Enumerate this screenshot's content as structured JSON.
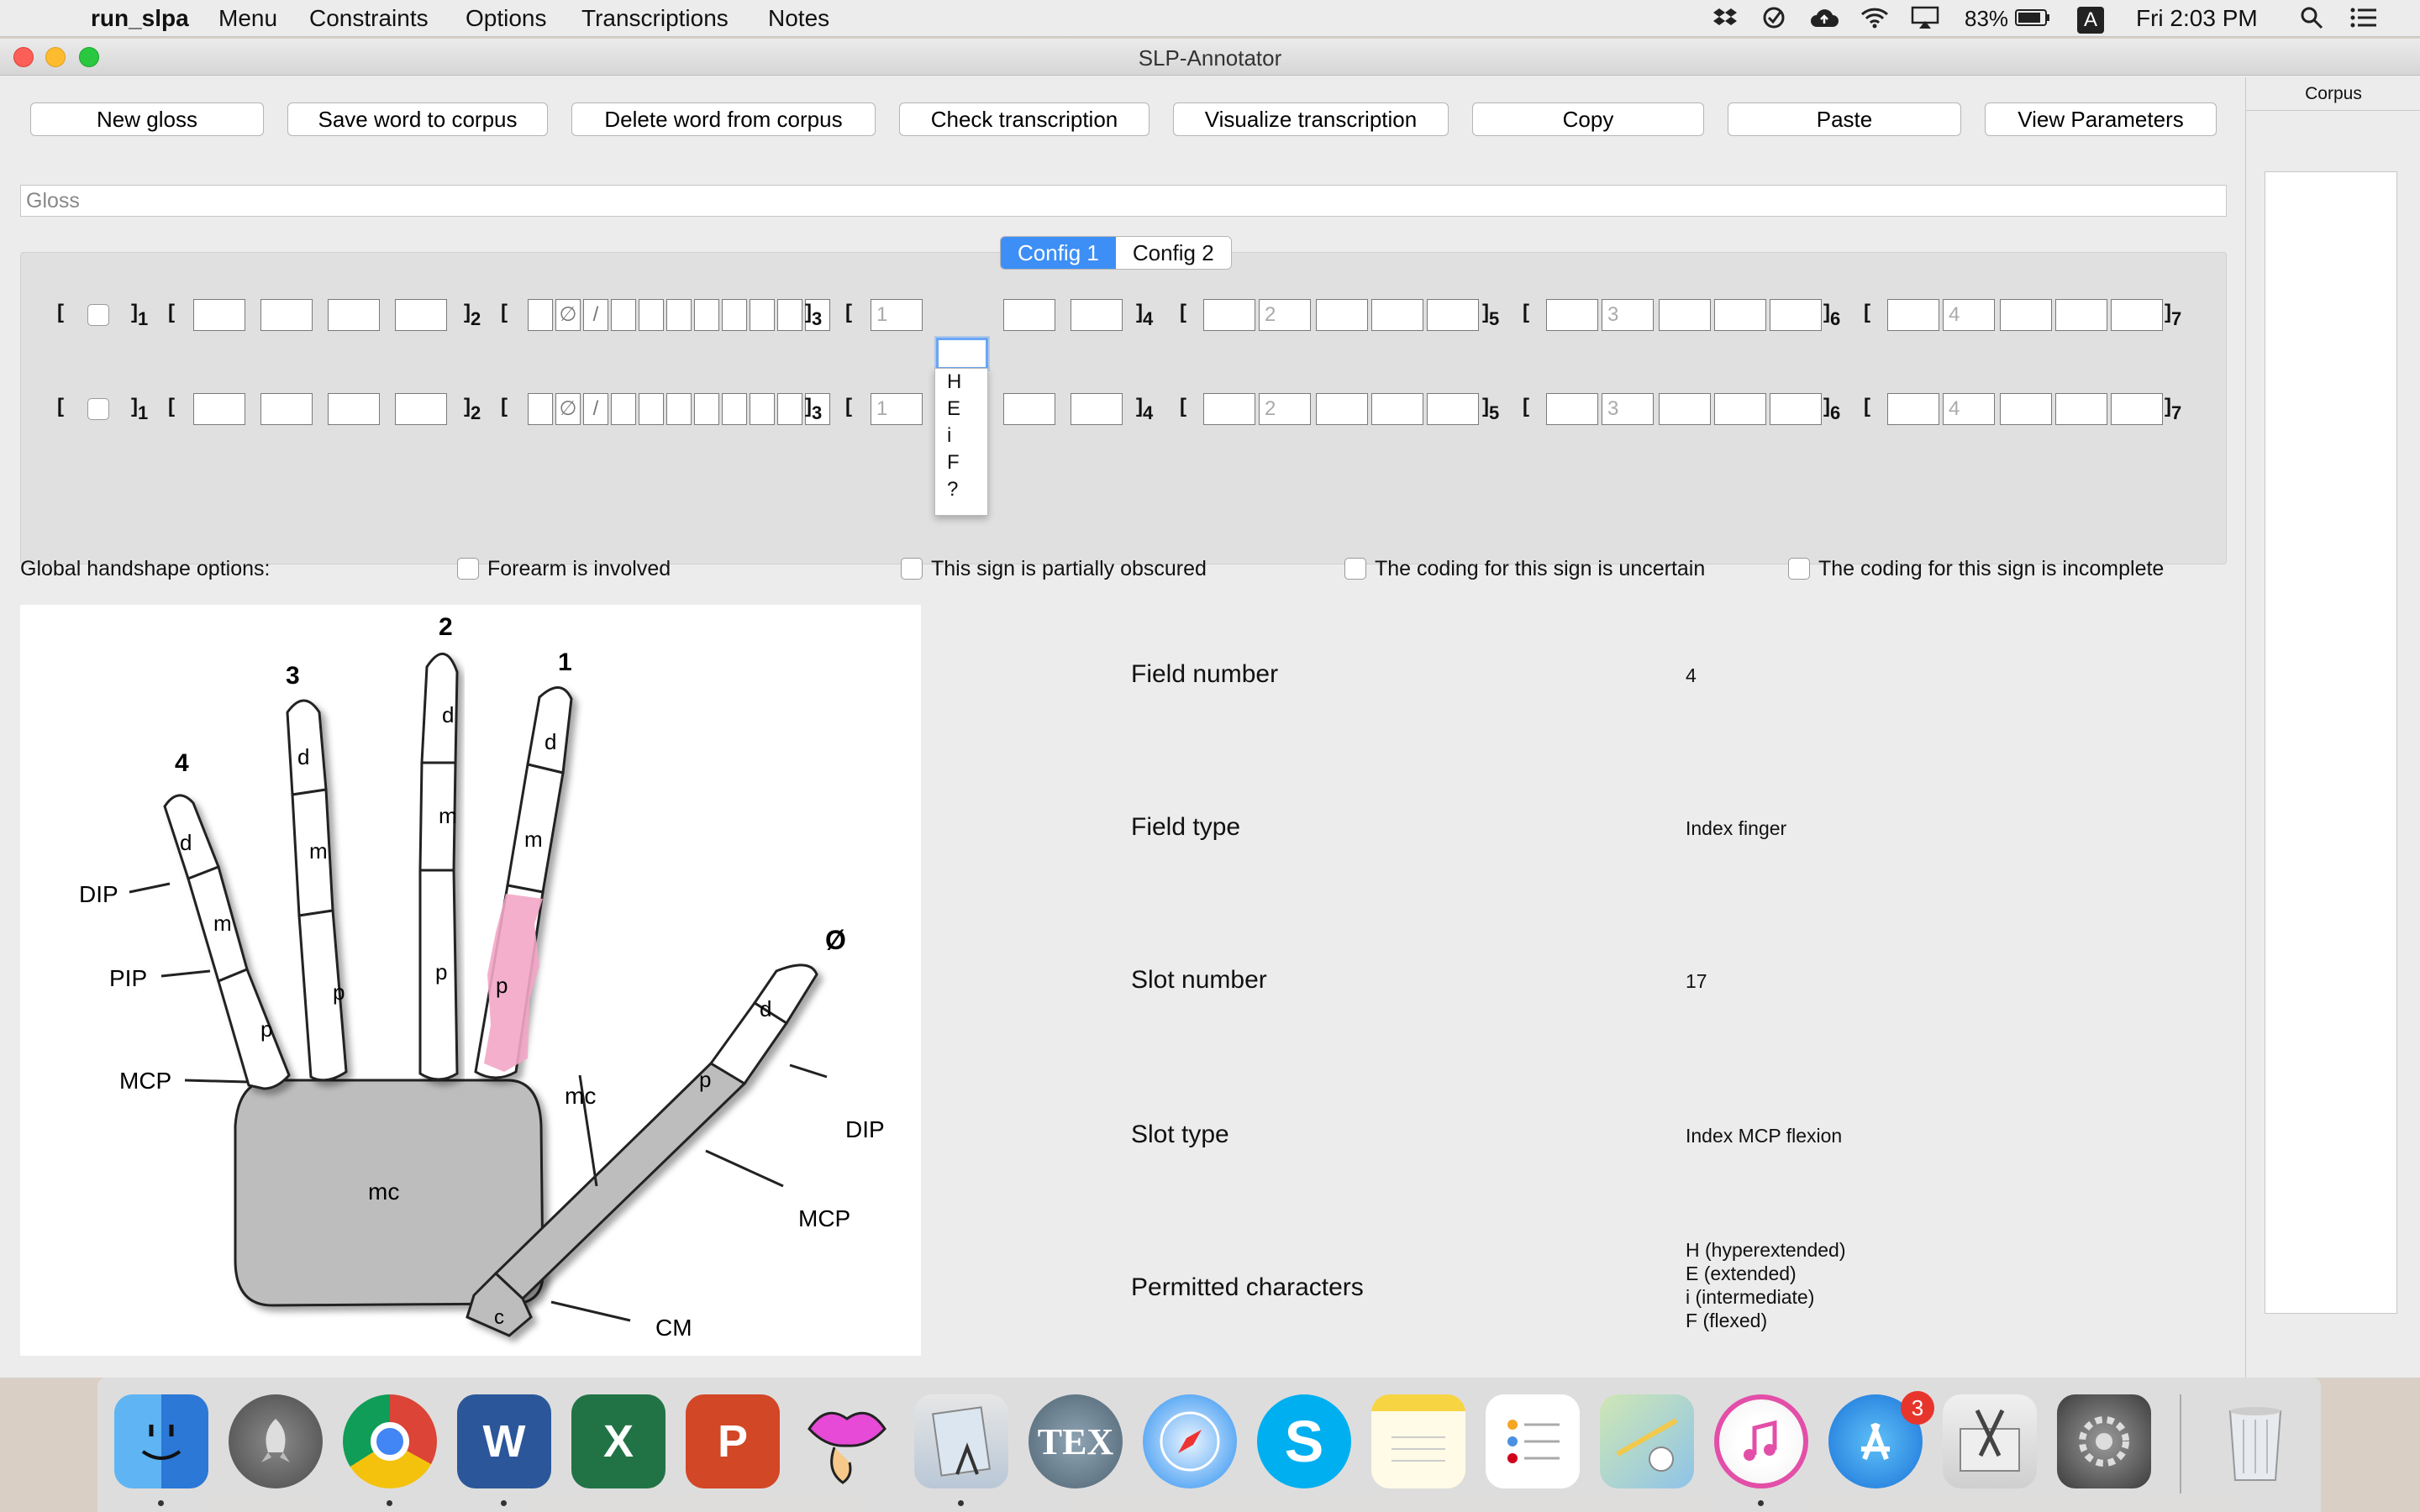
{
  "menubar": {
    "app_name": "run_slpa",
    "items": [
      "Menu",
      "Constraints",
      "Options",
      "Transcriptions",
      "Notes"
    ],
    "battery": "83%",
    "clock": "Fri 2:03 PM",
    "input_source": "A",
    "icons": [
      "apple-icon",
      "dropbox-icon",
      "clock-check-icon",
      "cloud-upload-icon",
      "wifi-icon",
      "airplay-icon",
      "battery-icon",
      "input-source-icon",
      "spotlight-icon",
      "notification-center-icon"
    ]
  },
  "window": {
    "title": "SLP-Annotator"
  },
  "toolbar": {
    "buttons": [
      "New gloss",
      "Save word to corpus",
      "Delete word from corpus",
      "Check transcription",
      "Visualize transcription",
      "Copy",
      "Paste",
      "View Parameters"
    ]
  },
  "gloss": {
    "placeholder": "Gloss"
  },
  "config_tabs": [
    "Config 1",
    "Config 2"
  ],
  "transcription": {
    "subscripts": [
      "1",
      "2",
      "3",
      "4",
      "5",
      "6",
      "7"
    ],
    "field3_symbols": [
      "∅",
      "/"
    ],
    "field_defaults": [
      "1",
      "2",
      "3",
      "4"
    ],
    "dropdown_options": [
      "H",
      "E",
      "i",
      "F",
      "?"
    ]
  },
  "global_options": {
    "label": "Global handshape options:",
    "checkboxes": [
      "Forearm is involved",
      "This sign is partially obscured",
      "The coding for this sign is uncertain",
      "The coding for this sign is incomplete"
    ]
  },
  "hand_diagram": {
    "finger_numbers": [
      "4",
      "3",
      "2",
      "1"
    ],
    "thumb_label": "Ø",
    "segment_labels": [
      "d",
      "m",
      "p",
      "mc",
      "c"
    ],
    "joint_labels": [
      "DIP",
      "PIP",
      "MCP",
      "DIP",
      "MCP",
      "CM",
      "mc"
    ],
    "highlight_color": "#f3a6c6"
  },
  "field_info": {
    "rows": [
      {
        "label": "Field number",
        "value": "4"
      },
      {
        "label": "Field type",
        "value": "Index finger"
      },
      {
        "label": "Slot number",
        "value": "17"
      },
      {
        "label": "Slot type",
        "value": "Index MCP flexion"
      },
      {
        "label": "Permitted characters",
        "values": [
          "H (hyperextended)",
          "E (extended)",
          "i (intermediate)",
          "F (flexed)"
        ]
      }
    ]
  },
  "corpus": {
    "header": "Corpus"
  },
  "dock": {
    "apps": [
      "finder-icon",
      "launchpad-icon",
      "chrome-icon",
      "word-icon",
      "excel-icon",
      "powerpoint-icon",
      "lips-app-icon",
      "preview-icon",
      "tex-icon",
      "safari-icon",
      "skype-icon",
      "notes-icon",
      "reminders-icon",
      "maps-icon",
      "itunes-icon",
      "app-store-icon",
      "scissors-app-icon",
      "system-preferences-icon",
      "trash-icon"
    ],
    "app_store_badge": "3",
    "letters": {
      "word": "W",
      "excel": "X",
      "powerpoint": "P",
      "skype": "S",
      "tex": "TEX"
    }
  }
}
